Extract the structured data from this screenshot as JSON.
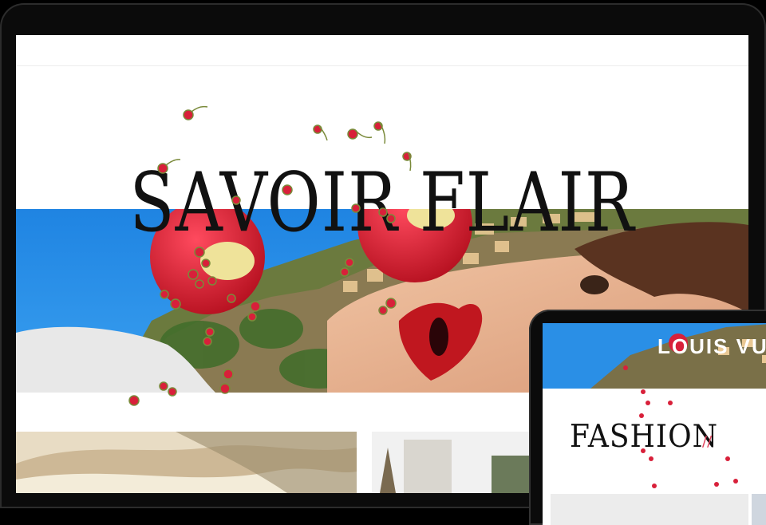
{
  "hero": {
    "title": "SAVOIR FLAIR"
  },
  "tablet": {
    "brand": "LOUIS VU",
    "section_title": "FASHION"
  },
  "colors": {
    "sky": "#2a8fe6",
    "cherry": "#d8203a",
    "lips": "#c0171f",
    "skin": "#e8b08e"
  }
}
